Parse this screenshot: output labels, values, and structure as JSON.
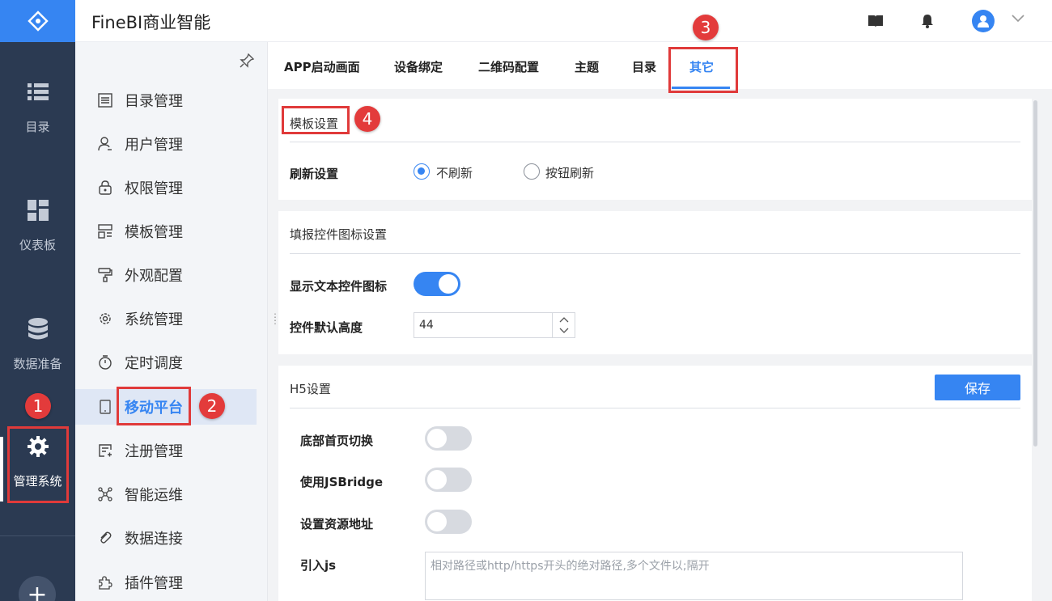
{
  "header": {
    "brand": "FineBI商业智能"
  },
  "rail": {
    "items": [
      {
        "label": "目录",
        "icon": "list-icon"
      },
      {
        "label": "仪表板",
        "icon": "dashboard-icon"
      },
      {
        "label": "数据准备",
        "icon": "database-icon"
      },
      {
        "label": "管理系统",
        "icon": "gear-icon",
        "active": true
      }
    ],
    "add_label": "+"
  },
  "sidebar": {
    "items": [
      {
        "label": "目录管理",
        "icon": "catalog-icon"
      },
      {
        "label": "用户管理",
        "icon": "user-icon"
      },
      {
        "label": "权限管理",
        "icon": "lock-icon"
      },
      {
        "label": "模板管理",
        "icon": "template-icon"
      },
      {
        "label": "外观配置",
        "icon": "paint-roller-icon"
      },
      {
        "label": "系统管理",
        "icon": "settings-icon"
      },
      {
        "label": "定时调度",
        "icon": "timer-icon"
      },
      {
        "label": "移动平台",
        "icon": "tablet-icon",
        "active": true
      },
      {
        "label": "注册管理",
        "icon": "register-icon"
      },
      {
        "label": "智能运维",
        "icon": "network-icon"
      },
      {
        "label": "数据连接",
        "icon": "link-icon"
      },
      {
        "label": "插件管理",
        "icon": "plugin-icon"
      }
    ]
  },
  "tabs": [
    {
      "label": "APP启动画面"
    },
    {
      "label": "设备绑定"
    },
    {
      "label": "二维码配置"
    },
    {
      "label": "主题"
    },
    {
      "label": "目录"
    },
    {
      "label": "其它",
      "active": true
    }
  ],
  "template_panel": {
    "title": "模板设置",
    "refresh_label": "刷新设置",
    "options": [
      {
        "label": "不刷新",
        "checked": true
      },
      {
        "label": "按钮刷新",
        "checked": false
      }
    ]
  },
  "fill_panel": {
    "title": "填报控件图标设置",
    "show_icon_label": "显示文本控件图标",
    "show_icon_on": true,
    "height_label": "控件默认高度",
    "height_value": "44"
  },
  "h5_panel": {
    "title": "H5设置",
    "save_label": "保存",
    "bottom_switch_label": "底部首页切换",
    "bottom_switch_on": false,
    "jsbridge_label": "使用JSBridge",
    "jsbridge_on": false,
    "resource_label": "设置资源地址",
    "resource_on": false,
    "js_label": "引入js",
    "js_placeholder": "相对路径或http/https开头的绝对路径,多个文件以;隔开"
  },
  "annotations": [
    "1",
    "2",
    "3",
    "4"
  ],
  "colors": {
    "accent": "#3685f2",
    "rail": "#2b3a52",
    "highlight": "#e03a3a"
  }
}
